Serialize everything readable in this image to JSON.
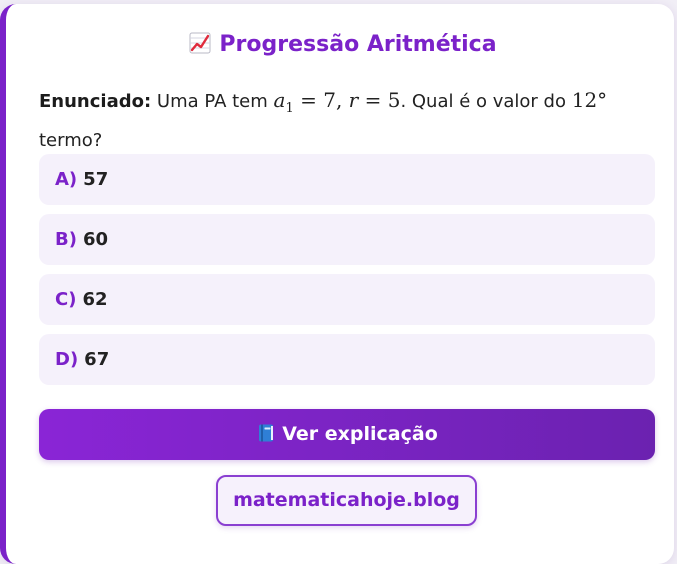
{
  "header": {
    "icon": "chart-increasing-icon",
    "title": "Progressão Aritmética"
  },
  "question": {
    "label": "Enunciado:",
    "text_before": "Uma PA tem",
    "text_after": ". Qual é o valor do",
    "text_end": "termo?",
    "math": {
      "a_var": "a",
      "a_sub": "1",
      "a_eq": "= 7,",
      "r_var": "r",
      "r_eq": "= 5",
      "ordinal": "12°"
    }
  },
  "options": [
    {
      "letter": "A)",
      "value": "57"
    },
    {
      "letter": "B)",
      "value": "60"
    },
    {
      "letter": "C)",
      "value": "62"
    },
    {
      "letter": "D)",
      "value": "67"
    }
  ],
  "explain_button": {
    "icon": "blue-book-icon",
    "label": "Ver explicação"
  },
  "footer": {
    "link_label": "matematicahoje.blog"
  },
  "colors": {
    "accent": "#7b22c9",
    "option_bg": "#f5f1fb",
    "button_gradient_start": "#8a25d6",
    "button_gradient_end": "#6b22b0"
  }
}
